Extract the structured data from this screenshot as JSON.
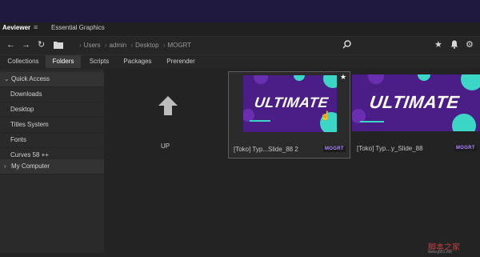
{
  "panel": {
    "tabs": [
      {
        "label": "Aeviewer",
        "active": true
      },
      {
        "label": "Essential Graphics",
        "active": false
      }
    ],
    "menu_icon": "hamburger-icon"
  },
  "navbar": {
    "icons": [
      "arrow-left-icon",
      "arrow-right-icon",
      "refresh-icon",
      "folder-icon"
    ],
    "breadcrumb": [
      "Users",
      "admin",
      "Desktop",
      "MOGRT"
    ],
    "right_icons": [
      "search-icon",
      "star-icon",
      "bell-icon",
      "gear-icon"
    ]
  },
  "tabs": [
    {
      "label": "Collections",
      "active": false
    },
    {
      "label": "Folders",
      "active": true
    },
    {
      "label": "Scripts",
      "active": false
    },
    {
      "label": "Packages",
      "active": false
    },
    {
      "label": "Prerender",
      "active": false
    }
  ],
  "sidebar": {
    "quick_access": "Quick Access",
    "items": [
      "Downloads",
      "Desktop",
      "Titles System",
      "Fonts",
      "Curves 58 ++"
    ],
    "my_computer": "My Computer"
  },
  "content": {
    "up_label": "UP",
    "cards": [
      {
        "name": "[Toko] Typ...Slide_88 2",
        "badge": "MOGRT",
        "thumb_text": "ULTIMATE",
        "selected": true,
        "favorite": true
      },
      {
        "name": "[Toko] Typ...y_Slide_88",
        "badge": "MOGRT",
        "thumb_text": "ULTIMATE",
        "selected": false,
        "favorite": false
      }
    ]
  },
  "watermark": {
    "text": "脚本之家",
    "sub": "www.jb51.net"
  },
  "colors": {
    "titlebar": "#1f1940",
    "thumb_bg": "#4b1d86",
    "accent_teal": "#3bd6c6",
    "badge": "#b28bff"
  }
}
